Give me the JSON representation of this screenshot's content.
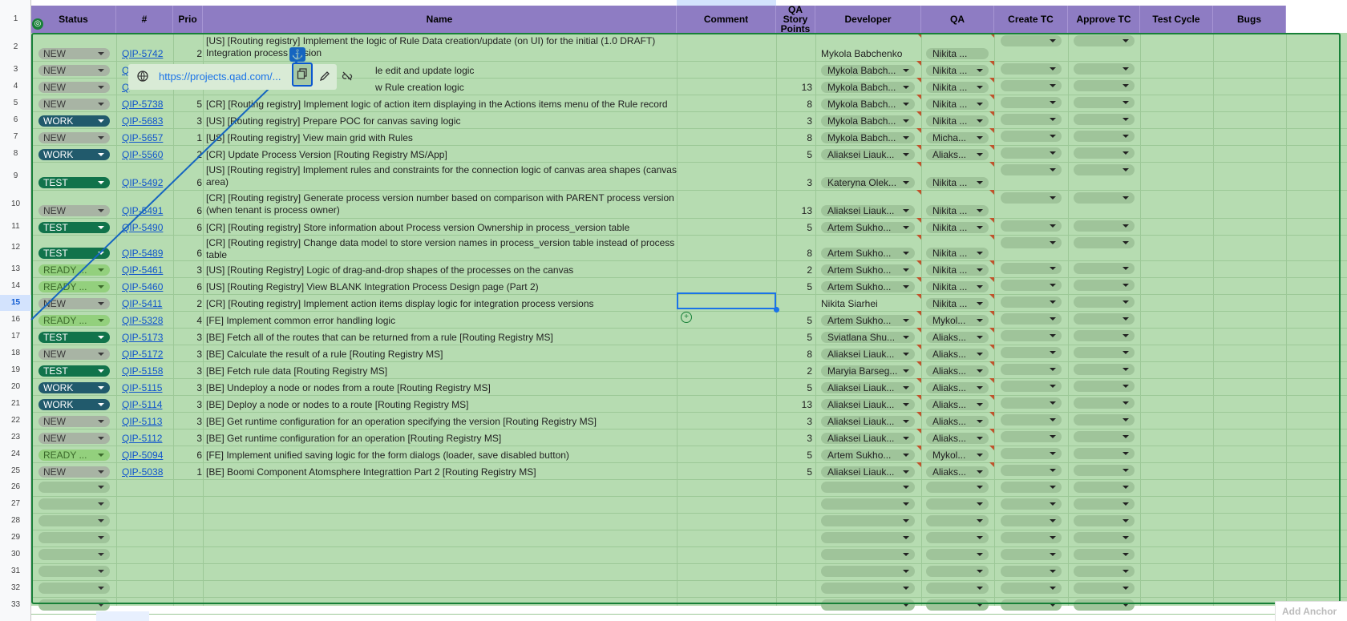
{
  "columns": {
    "status": "Status",
    "num": "#",
    "prio": "Prio",
    "name": "Name",
    "comment": "Comment",
    "qa_points": "QA Story Points",
    "developer": "Developer",
    "qa": "QA",
    "create_tc": "Create TC",
    "approve_tc": "Approve TC",
    "test_cycle": "Test Cycle",
    "bugs": "Bugs"
  },
  "rows": [
    {
      "n": "2",
      "status": "NEW",
      "id": "QIP-5742",
      "prio": "2",
      "name": "[US] [Routing registry] Implement the logic of Rule Data creation/update (on UI) for the initial (1.0 DRAFT) Integration process version",
      "points": "",
      "dev": "Mykola Babchenko",
      "qa": "Nikita ..."
    },
    {
      "n": "3",
      "status": "NEW",
      "id": "Q",
      "prio": "",
      "name": "le edit and update logic",
      "points": "",
      "dev": "Mykola Babch...",
      "qa": "Nikita ..."
    },
    {
      "n": "4",
      "status": "NEW",
      "id": "Q",
      "prio": "",
      "name": "w Rule creation logic",
      "points": "13",
      "dev": "Mykola Babch...",
      "qa": "Nikita ..."
    },
    {
      "n": "5",
      "status": "NEW",
      "id": "QIP-5738",
      "prio": "5",
      "name": "[CR] [Routing registry] Implement logic of action item displaying in the Actions items menu of the Rule record",
      "points": "8",
      "dev": "Mykola Babch...",
      "qa": "Nikita ..."
    },
    {
      "n": "6",
      "status": "WORK",
      "id": "QIP-5683",
      "prio": "3",
      "name": "[US] [Routing registry] Prepare POC for canvas saving logic",
      "points": "3",
      "dev": "Mykola Babch...",
      "qa": "Nikita ..."
    },
    {
      "n": "7",
      "status": "NEW",
      "id": "QIP-5657",
      "prio": "1",
      "name": "[US] [Routing registry] View main grid with Rules",
      "points": "8",
      "dev": "Mykola Babch...",
      "qa": "Micha..."
    },
    {
      "n": "8",
      "status": "WORK",
      "id": "QIP-5560",
      "prio": "2",
      "name": "[CR] Update Process Version [Routing Registry MS/App]",
      "points": "5",
      "dev": "Aliaksei Liauk...",
      "qa": "Aliaks..."
    },
    {
      "n": "9",
      "status": "TEST",
      "id": "QIP-5492",
      "prio": "6",
      "name": "[US] [Routing registry] Implement rules and constraints for the connection logic of canvas area shapes (canvas area)",
      "points": "3",
      "dev": "Kateryna Olek...",
      "qa": "Nikita ..."
    },
    {
      "n": "10",
      "status": "NEW",
      "id": "QIP-5491",
      "prio": "6",
      "name": "[CR] [Routing registry] Generate process version number based on comparison with PARENT process version (when tenant is process owner)",
      "points": "13",
      "dev": "Aliaksei Liauk...",
      "qa": "Nikita ..."
    },
    {
      "n": "11",
      "status": "TEST",
      "id": "QIP-5490",
      "prio": "6",
      "name": "[CR] [Routing registry] Store information about Process version Ownership in process_version table",
      "points": "5",
      "dev": "Artem Sukho...",
      "qa": "Nikita ..."
    },
    {
      "n": "12",
      "status": "TEST",
      "id": "QIP-5489",
      "prio": "6",
      "name": "[CR] [Routing registry] Change data model to store version names in process_version table instead of process table",
      "points": "8",
      "dev": "Artem Sukho...",
      "qa": "Nikita ..."
    },
    {
      "n": "13",
      "status": "READY ...",
      "id": "QIP-5461",
      "prio": "3",
      "name": "[US] [Routing Registry] Logic of drag-and-drop shapes of the processes on the canvas",
      "points": "2",
      "dev": "Artem Sukho...",
      "qa": "Nikita ..."
    },
    {
      "n": "14",
      "status": "READY ...",
      "id": "QIP-5460",
      "prio": "6",
      "name": "[US] [Routing Registry] View BLANK Integration Process Design page (Part 2)",
      "points": "5",
      "dev": "Artem Sukho...",
      "qa": "Nikita ..."
    },
    {
      "n": "15",
      "status": "NEW",
      "id": "QIP-5411",
      "prio": "2",
      "name": "[CR] [Routing registry] Implement action items display logic for integration process versions",
      "points": "",
      "dev": "Nikita Siarhei",
      "qa": "Nikita ..."
    },
    {
      "n": "16",
      "status": "READY ...",
      "id": "QIP-5328",
      "prio": "4",
      "name": "[FE] Implement common error handling logic",
      "points": "5",
      "dev": "Artem Sukho...",
      "qa": "Mykol..."
    },
    {
      "n": "17",
      "status": "TEST",
      "id": "QIP-5173",
      "prio": "3",
      "name": "[BE] Fetch all of the routes that can be returned from a rule [Routing Registry MS]",
      "points": "5",
      "dev": "Sviatlana Shu...",
      "qa": "Aliaks..."
    },
    {
      "n": "18",
      "status": "NEW",
      "id": "QIP-5172",
      "prio": "3",
      "name": "[BE] Calculate the result of a rule [Routing Registry MS]",
      "points": "8",
      "dev": "Aliaksei Liauk...",
      "qa": "Aliaks..."
    },
    {
      "n": "19",
      "status": "TEST",
      "id": "QIP-5158",
      "prio": "3",
      "name": "[BE] Fetch rule data [Routing Registry MS]",
      "points": "2",
      "dev": "Maryia Barseg...",
      "qa": "Aliaks..."
    },
    {
      "n": "20",
      "status": "WORK",
      "id": "QIP-5115",
      "prio": "3",
      "name": "[BE] Undeploy a node or nodes from a route [Routing Registry MS]",
      "points": "5",
      "dev": "Aliaksei Liauk...",
      "qa": "Aliaks..."
    },
    {
      "n": "21",
      "status": "WORK",
      "id": "QIP-5114",
      "prio": "3",
      "name": "[BE] Deploy a node or nodes to a route [Routing Registry MS]",
      "points": "13",
      "dev": "Aliaksei Liauk...",
      "qa": "Aliaks..."
    },
    {
      "n": "22",
      "status": "NEW",
      "id": "QIP-5113",
      "prio": "3",
      "name": "[BE] Get runtime configuration for an operation specifying the version [Routing Registry MS]",
      "points": "3",
      "dev": "Aliaksei Liauk...",
      "qa": "Aliaks..."
    },
    {
      "n": "23",
      "status": "NEW",
      "id": "QIP-5112",
      "prio": "3",
      "name": "[BE] Get runtime configuration for an operation [Routing Registry MS]",
      "points": "3",
      "dev": "Aliaksei Liauk...",
      "qa": "Aliaks..."
    },
    {
      "n": "24",
      "status": "READY ...",
      "id": "QIP-5094",
      "prio": "6",
      "name": "[FE] Implement unified saving logic for the form dialogs (loader, save disabled button)",
      "points": "5",
      "dev": "Artem Sukho...",
      "qa": "Mykol..."
    },
    {
      "n": "25",
      "status": "NEW",
      "id": "QIP-5038",
      "prio": "1",
      "name": "[BE] Boomi Component Atomsphere Integrattion Part 2 [Routing Registry MS]",
      "points": "5",
      "dev": "Aliaksei Liauk...",
      "qa": "Aliaks..."
    }
  ],
  "empty_rows": [
    "26",
    "27",
    "28",
    "29",
    "30",
    "31",
    "32",
    "33"
  ],
  "header_row_num": "1",
  "link_popup": {
    "url": "https://projects.qad.com/..."
  },
  "add_anchor_label": "Add Anchor",
  "colors": {
    "header": "#8e7cc3",
    "row_bg": "#b6dcb1",
    "selection": "#188038"
  }
}
